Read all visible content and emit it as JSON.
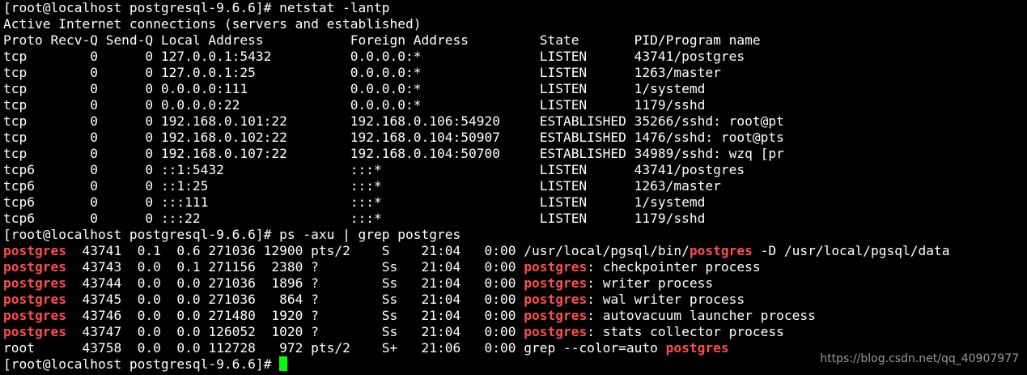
{
  "terminal": {
    "highlight_color": "#ff4d4d",
    "cursor_color": "#00ff00",
    "lines": [
      [
        {
          "t": "[root@localhost postgresql-9.6.6]# netstat -lantp"
        }
      ],
      [
        {
          "t": "Active Internet connections (servers and established)"
        }
      ],
      [
        {
          "t": "Proto Recv-Q Send-Q Local Address           Foreign Address         State       PID/Program name"
        }
      ],
      [
        {
          "t": "tcp        0      0 127.0.0.1:5432          0.0.0.0:*               LISTEN      43741/postgres"
        }
      ],
      [
        {
          "t": "tcp        0      0 127.0.0.1:25            0.0.0.0:*               LISTEN      1263/master"
        }
      ],
      [
        {
          "t": "tcp        0      0 0.0.0.0:111             0.0.0.0:*               LISTEN      1/systemd"
        }
      ],
      [
        {
          "t": "tcp        0      0 0.0.0.0:22              0.0.0.0:*               LISTEN      1179/sshd"
        }
      ],
      [
        {
          "t": "tcp        0      0 192.168.0.101:22        192.168.0.106:54920     ESTABLISHED 35266/sshd: root@pt"
        }
      ],
      [
        {
          "t": "tcp        0      0 192.168.0.102:22        192.168.0.104:50907     ESTABLISHED 1476/sshd: root@pts"
        }
      ],
      [
        {
          "t": "tcp        0      0 192.168.0.107:22        192.168.0.104:50700     ESTABLISHED 34989/sshd: wzq [pr"
        }
      ],
      [
        {
          "t": "tcp6       0      0 ::1:5432                :::*                    LISTEN      43741/postgres"
        }
      ],
      [
        {
          "t": "tcp6       0      0 ::1:25                  :::*                    LISTEN      1263/master"
        }
      ],
      [
        {
          "t": "tcp6       0      0 :::111                  :::*                    LISTEN      1/systemd"
        }
      ],
      [
        {
          "t": "tcp6       0      0 :::22                   :::*                    LISTEN      1179/sshd"
        }
      ],
      [
        {
          "t": "[root@localhost postgresql-9.6.6]# ps -axu | grep postgres"
        }
      ],
      [
        {
          "t": "postgres",
          "h": true
        },
        {
          "t": "  43741  0.1  0.6 271036 12900 pts/2    S    21:04   0:00 /usr/local/pgsql/bin/"
        },
        {
          "t": "postgres",
          "h": true
        },
        {
          "t": " -D /usr/local/pgsql/data"
        }
      ],
      [
        {
          "t": "postgres",
          "h": true
        },
        {
          "t": "  43743  0.0  0.1 271156  2380 ?        Ss   21:04   0:00 "
        },
        {
          "t": "postgres",
          "h": true
        },
        {
          "t": ": checkpointer process"
        }
      ],
      [
        {
          "t": "postgres",
          "h": true
        },
        {
          "t": "  43744  0.0  0.0 271036  1896 ?        Ss   21:04   0:00 "
        },
        {
          "t": "postgres",
          "h": true
        },
        {
          "t": ": writer process"
        }
      ],
      [
        {
          "t": "postgres",
          "h": true
        },
        {
          "t": "  43745  0.0  0.0 271036   864 ?        Ss   21:04   0:00 "
        },
        {
          "t": "postgres",
          "h": true
        },
        {
          "t": ": wal writer process"
        }
      ],
      [
        {
          "t": "postgres",
          "h": true
        },
        {
          "t": "  43746  0.0  0.0 271480  1920 ?        Ss   21:04   0:00 "
        },
        {
          "t": "postgres",
          "h": true
        },
        {
          "t": ": autovacuum launcher process"
        }
      ],
      [
        {
          "t": "postgres",
          "h": true
        },
        {
          "t": "  43747  0.0  0.0 126052  1020 ?        Ss   21:04   0:00 "
        },
        {
          "t": "postgres",
          "h": true
        },
        {
          "t": ": stats collector process"
        }
      ],
      [
        {
          "t": "root      43758  0.0  0.0 112728   972 pts/2    S+   21:06   0:00 grep --color=auto "
        },
        {
          "t": "postgres",
          "h": true
        }
      ],
      [
        {
          "t": "[root@localhost postgresql-9.6.6]# "
        },
        {
          "cursor": true
        }
      ]
    ]
  },
  "watermark": "https://blog.csdn.net/qq_40907977"
}
